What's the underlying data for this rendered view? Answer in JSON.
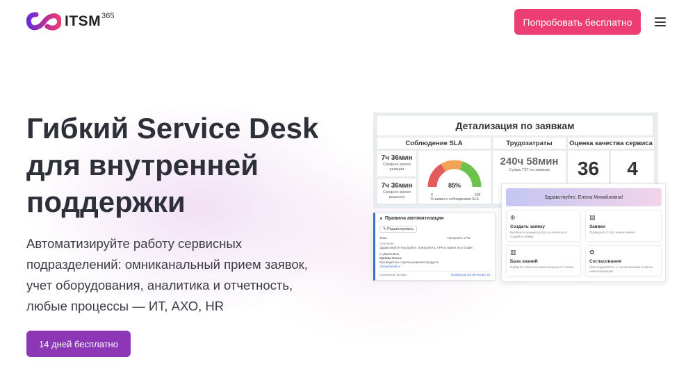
{
  "header": {
    "logo_text": "ITSM",
    "logo_sup": "365",
    "try_button": "Попробовать бесплатно",
    "menu_icon": "hamburger-icon"
  },
  "hero": {
    "title_lines": [
      "Гибкий Service Desk",
      "для внутренней",
      "поддержки"
    ],
    "subtitle_lines": [
      "Автоматизируйте работу сервисных",
      "подразделений: омниканальный прием заявок,",
      "учет оборудования, аналитика и отчетность,",
      "любые процессы — ИТ, АХО, HR"
    ],
    "cta_button": "14 дней бесплатно"
  },
  "dashboard": {
    "title": "Детализация по заявкам",
    "sla": {
      "header": "Соблюдение SLA",
      "metric1_value": "7ч 36мин",
      "metric1_label": "Среднее время реакции",
      "metric2_value": "7ч 36мин",
      "metric2_label": "Среднее время решения",
      "gauge_value": "85%",
      "gauge_percent": 85,
      "gauge_min": "0",
      "gauge_max": "100",
      "gauge_caption": "% заявок с соблюдением SLA"
    },
    "labor": {
      "header": "Трудозатраты",
      "value": "240ч 58мин",
      "label": "Сумма ТЗТ по заявкам"
    },
    "quality": {
      "header": "Оценка качества сервиса",
      "value1": "36",
      "value2": "4"
    }
  },
  "automation": {
    "title": "Правила автоматизации",
    "edit_button": "Редактировать",
    "row1_label": "Тема",
    "row1_value": "Настроить VPN",
    "row2_label": "Описание",
    "row2_value": "Здравствуйте! Настройте, пожалуйста, VPN в офисе на 4 этаже.",
    "greeting": "С уважением,",
    "signer": "Орлова Ольга",
    "signer_role": "Руководитель отдела развития продукта",
    "signer_email": "orlova@mail.ru",
    "footer_label": "Связанные активы",
    "footer_link": "DS500 роутер Mi Router 4C"
  },
  "portal": {
    "greeting": "Здравствуйте, Елена Михайловна!",
    "tiles": [
      {
        "icon": "plus-circle-icon",
        "glyph": "⊕",
        "title": "Создать заявку",
        "desc": "Выберите нужную услугу из каталога и создайте заявку"
      },
      {
        "icon": "document-icon",
        "glyph": "▤",
        "title": "Заявки",
        "desc": "Проверьте статус ваших заявок"
      },
      {
        "icon": "books-icon",
        "glyph": "▥",
        "title": "База знаний",
        "desc": "Найдите ответы на ваши вопросы в статьях"
      },
      {
        "icon": "handshake-icon",
        "glyph": "✿",
        "title": "Согласования",
        "desc": "Присоединяйтесь к согласованиям и ваших инвентаризаций"
      }
    ]
  },
  "colors": {
    "try_button": "#ec3d74",
    "cta_button": "#8d37b7",
    "gauge_red": "#e35a5a",
    "gauge_orange": "#f0a45a",
    "gauge_green": "#6cc24a"
  }
}
